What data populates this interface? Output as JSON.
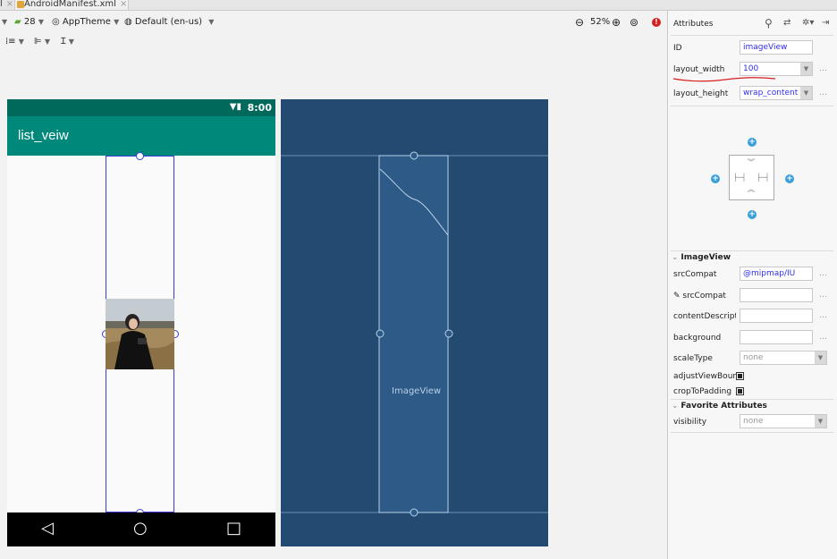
{
  "tabs": [
    {
      "label": "l",
      "close": "×"
    },
    {
      "label": "AndroidManifest.xml",
      "close": "×"
    }
  ],
  "toolbar": {
    "api_level": "28",
    "theme": "AppTheme",
    "locale": "Default (en-us)",
    "zoom": "52%"
  },
  "phone": {
    "status_time": "8:00",
    "app_title": "list_veiw"
  },
  "blueprint": {
    "view_label": "ImageView"
  },
  "attributes": {
    "title": "Attributes",
    "rows": [
      {
        "label": "ID",
        "value": "imageView"
      },
      {
        "label": "layout_width",
        "value": "100"
      },
      {
        "label": "layout_height",
        "value": "wrap_content"
      }
    ],
    "imageview_section": "ImageView",
    "imageview_rows": [
      {
        "label": "srcCompat",
        "value": "@mipmap/IU"
      },
      {
        "label": "srcCompat",
        "value": ""
      },
      {
        "label": "contentDescriptio",
        "value": ""
      },
      {
        "label": "background",
        "value": ""
      },
      {
        "label": "scaleType",
        "value": "none"
      },
      {
        "label": "adjustViewBound",
        "value": ""
      },
      {
        "label": "cropToPadding",
        "value": ""
      }
    ],
    "favorite_section": "Favorite Attributes",
    "favorite_rows": [
      {
        "label": "visibility",
        "value": "none"
      }
    ]
  },
  "colors": {
    "app_bar": "#00897b",
    "status_bar": "#00695c",
    "blueprint": "#234b72",
    "selection": "#3b3bd6",
    "annotation": "#d62020"
  }
}
